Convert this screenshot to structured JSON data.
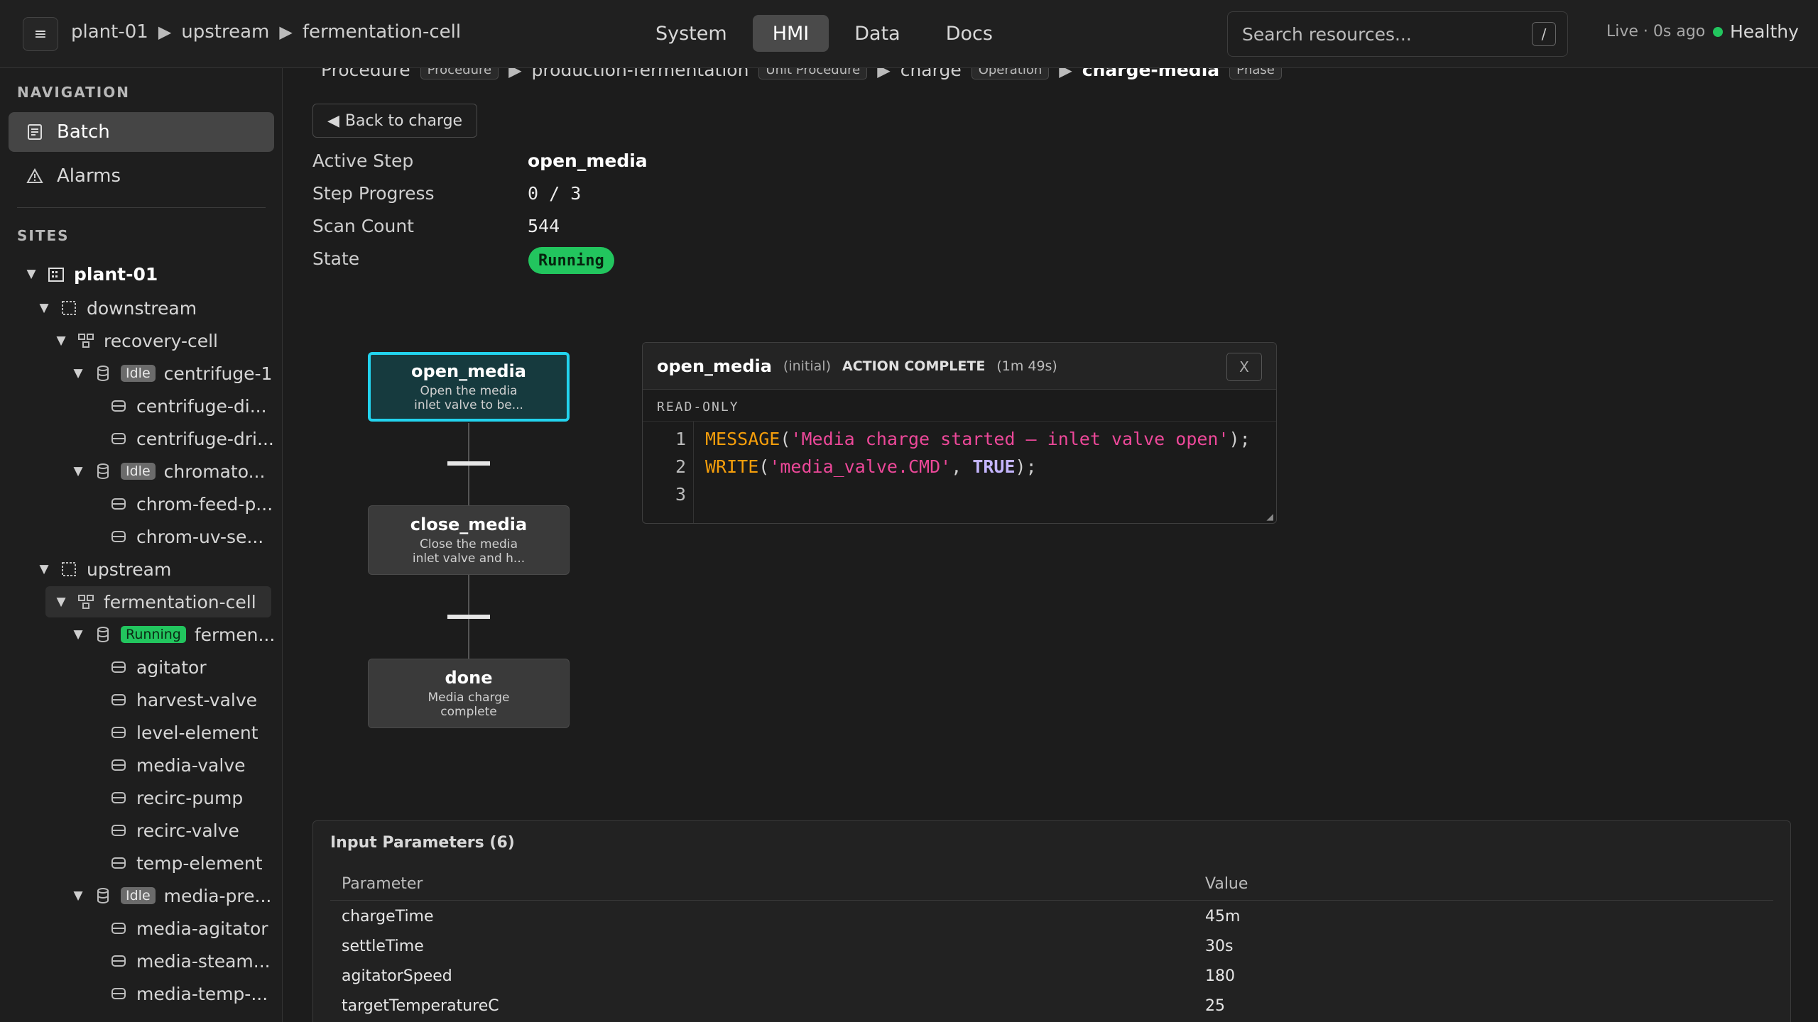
{
  "topbar": {
    "breadcrumb": [
      "plant-01",
      "upstream",
      "fermentation-cell"
    ],
    "tabs": [
      {
        "label": "System",
        "active": false
      },
      {
        "label": "HMI",
        "active": true
      },
      {
        "label": "Data",
        "active": false
      },
      {
        "label": "Docs",
        "active": false
      }
    ],
    "search_placeholder": "Search resources...",
    "search_shortcut": "/",
    "live_status": "Live · 0s ago",
    "health": "Healthy",
    "health_color": "#22c55e"
  },
  "sidebar": {
    "navigation_title": "NAVIGATION",
    "nav": [
      {
        "label": "Batch",
        "icon": "clipboard-icon",
        "active": true
      },
      {
        "label": "Alarms",
        "icon": "warning-triangle-icon",
        "active": false
      }
    ],
    "sites_title": "SITES",
    "tree": [
      {
        "label": "plant-01",
        "icon": "building-icon",
        "expanded": true
      },
      {
        "label": "downstream",
        "icon": "area-icon",
        "expanded": true
      },
      {
        "label": "recovery-cell",
        "icon": "cell-icon",
        "expanded": true
      },
      {
        "label": "centrifuge-1",
        "icon": "unit-icon",
        "badge": "Idle",
        "expanded": true
      },
      {
        "label": "centrifuge-di...",
        "icon": "module-icon"
      },
      {
        "label": "centrifuge-dri...",
        "icon": "module-icon"
      },
      {
        "label": "chromato...",
        "icon": "unit-icon",
        "badge": "Idle",
        "expanded": true
      },
      {
        "label": "chrom-feed-p...",
        "icon": "module-icon"
      },
      {
        "label": "chrom-uv-se...",
        "icon": "module-icon"
      },
      {
        "label": "upstream",
        "icon": "area-icon",
        "expanded": true
      },
      {
        "label": "fermentation-cell",
        "icon": "cell-icon",
        "expanded": true,
        "selected": true
      },
      {
        "label": "fermen...",
        "icon": "unit-icon",
        "badge": "Running",
        "expanded": true
      },
      {
        "label": "agitator",
        "icon": "module-icon"
      },
      {
        "label": "harvest-valve",
        "icon": "module-icon"
      },
      {
        "label": "level-element",
        "icon": "module-icon"
      },
      {
        "label": "media-valve",
        "icon": "module-icon"
      },
      {
        "label": "recirc-pump",
        "icon": "module-icon"
      },
      {
        "label": "recirc-valve",
        "icon": "module-icon"
      },
      {
        "label": "temp-element",
        "icon": "module-icon"
      },
      {
        "label": "media-pre...",
        "icon": "unit-icon",
        "badge": "Idle",
        "expanded": true
      },
      {
        "label": "media-agitator",
        "icon": "module-icon"
      },
      {
        "label": "media-steam...",
        "icon": "module-icon"
      },
      {
        "label": "media-temp-...",
        "icon": "module-icon"
      }
    ]
  },
  "procedure": {
    "crumbs": [
      {
        "label": "Procedure",
        "tag": "Procedure"
      },
      {
        "label": "production-fermentation",
        "tag": "Unit Procedure"
      },
      {
        "label": "charge",
        "tag": "Operation"
      },
      {
        "label": "charge-media",
        "tag": "Phase",
        "current": true
      }
    ],
    "back_label": "Back to charge",
    "details": [
      {
        "key": "Active Step",
        "value": "open_media"
      },
      {
        "key": "Step Progress",
        "value": "0 / 3"
      },
      {
        "key": "Scan Count",
        "value": "544"
      },
      {
        "key": "State",
        "value": "Running"
      }
    ],
    "state_color": "#22c55e"
  },
  "flow": {
    "steps": [
      {
        "name": "open_media",
        "desc": "Open the media inlet valve to be...",
        "active": true
      },
      {
        "name": "close_media",
        "desc": "Close the media inlet valve and h...",
        "active": false
      },
      {
        "name": "done",
        "desc": "Media charge complete",
        "active": false
      }
    ],
    "active_color": "#22d3ee"
  },
  "code_panel": {
    "step_name": "open_media",
    "initial_label": "(initial)",
    "status": "ACTION COMPLETE",
    "duration": "(1m 49s)",
    "close_label": "X",
    "readonly_label": "READ-ONLY",
    "lines": [
      {
        "n": "1",
        "fn": "MESSAGE",
        "open": "(",
        "arg1": "'Media charge started — inlet valve open'",
        "sep": "",
        "arg2": "",
        "close": ");"
      },
      {
        "n": "2",
        "fn": "WRITE",
        "open": "(",
        "arg1": "'media_valve.CMD'",
        "sep": ", ",
        "arg2": "TRUE",
        "close": ");"
      },
      {
        "n": "3",
        "fn": "",
        "open": "",
        "arg1": "",
        "sep": "",
        "arg2": "",
        "close": ""
      }
    ]
  },
  "params": {
    "title": "Input Parameters (6)",
    "columns": [
      "Parameter",
      "Value"
    ],
    "rows": [
      [
        "chargeTime",
        "45m"
      ],
      [
        "settleTime",
        "30s"
      ],
      [
        "agitatorSpeed",
        "180"
      ],
      [
        "targetTemperatureC",
        "25"
      ]
    ]
  }
}
